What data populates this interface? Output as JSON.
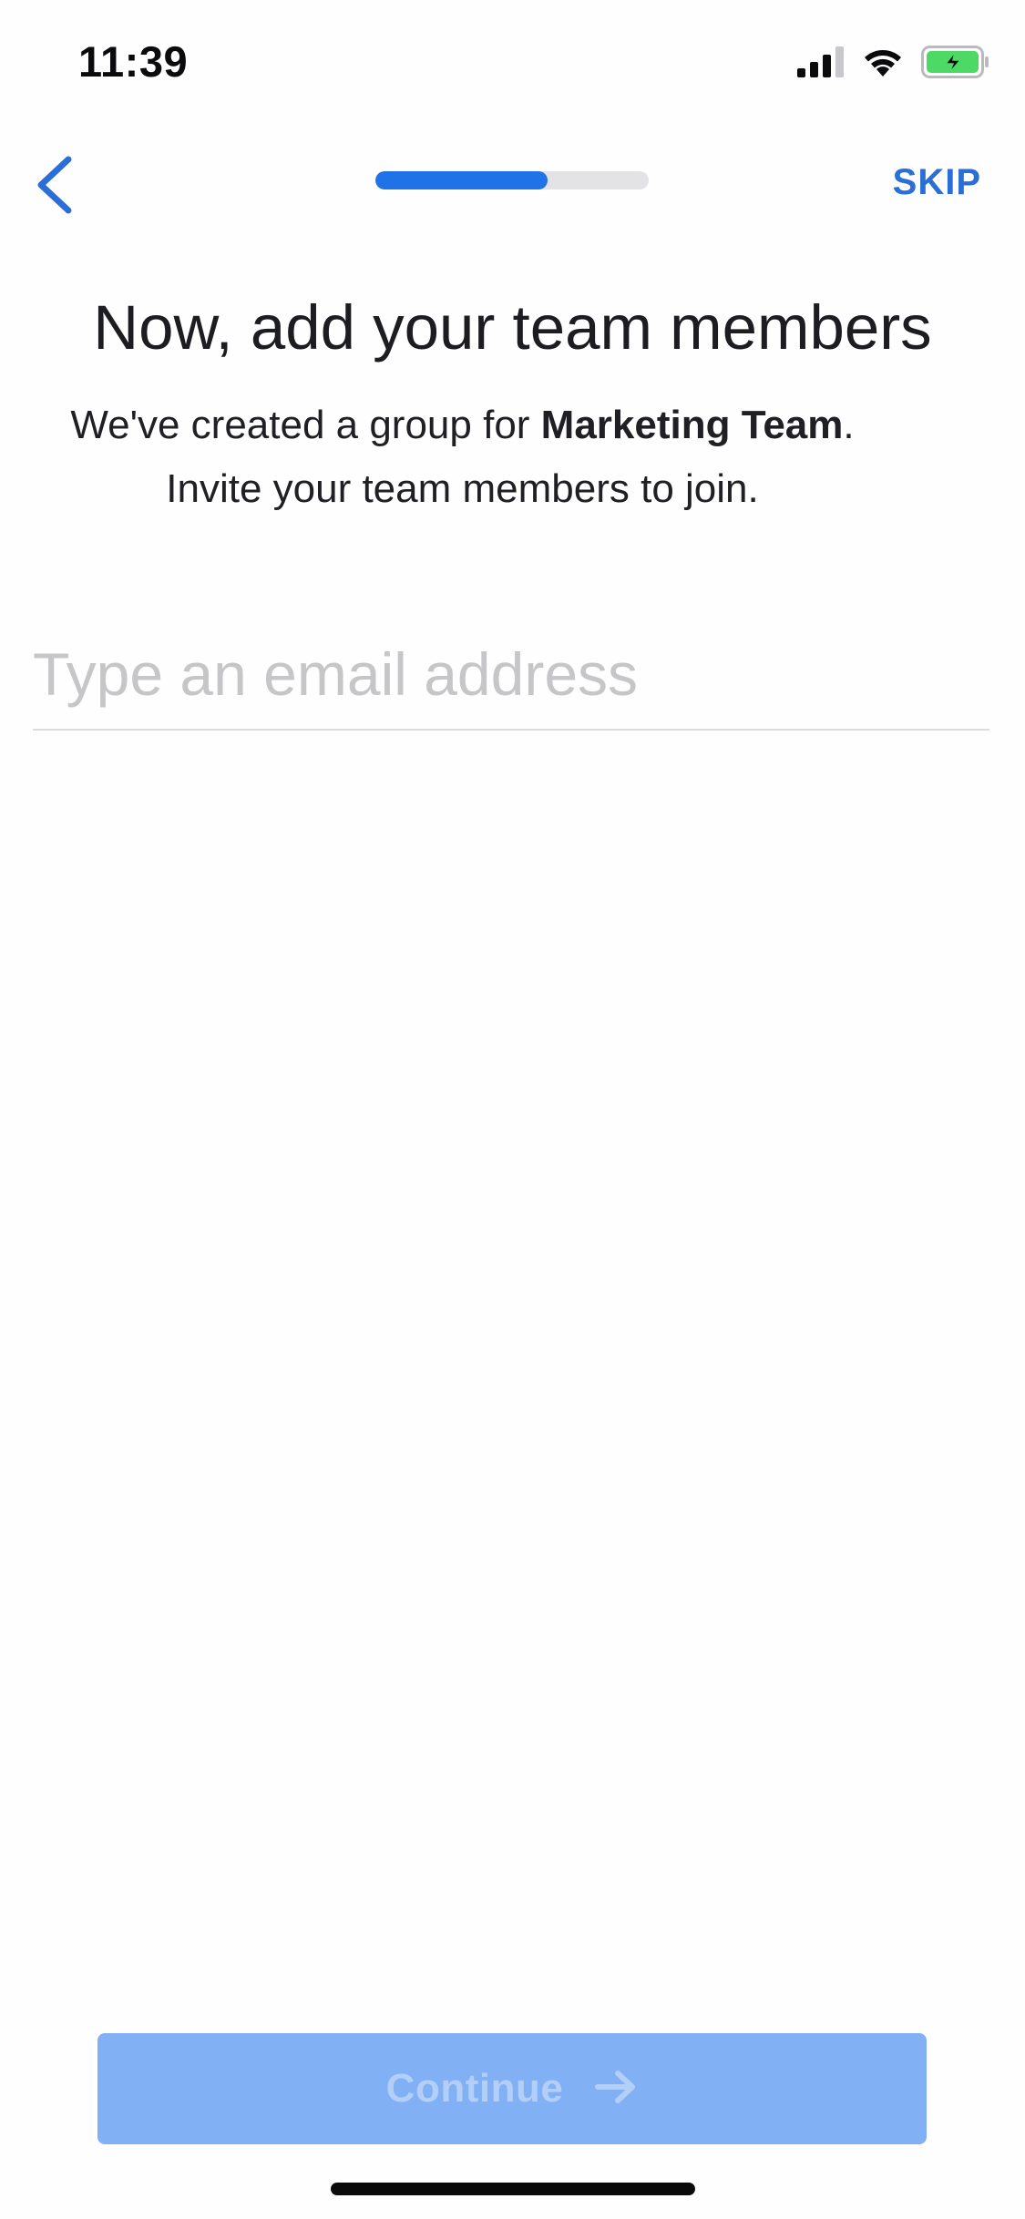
{
  "status_bar": {
    "time": "11:39",
    "icons": [
      "cellular-signal-icon",
      "wifi-icon",
      "battery-charging-icon"
    ]
  },
  "nav": {
    "back_icon": "chevron-left-icon",
    "skip_label": "SKIP",
    "progress": 0.63
  },
  "content": {
    "title": "Now, add your team members",
    "subtitle_prefix": "We've created a group for ",
    "group_name": "Marketing Team",
    "subtitle_suffix": ".",
    "subtitle_line2": "Invite your team members to join.",
    "email_value": "",
    "email_placeholder": "Type an email address"
  },
  "footer": {
    "continue_label": "Continue",
    "continue_icon": "arrow-right-icon"
  },
  "colors": {
    "accent": "#1f73e6",
    "link": "#2b6fd6",
    "button_disabled_bg": "#82b0f4",
    "button_disabled_text": "#b3cef7",
    "battery_green": "#4cd964"
  }
}
